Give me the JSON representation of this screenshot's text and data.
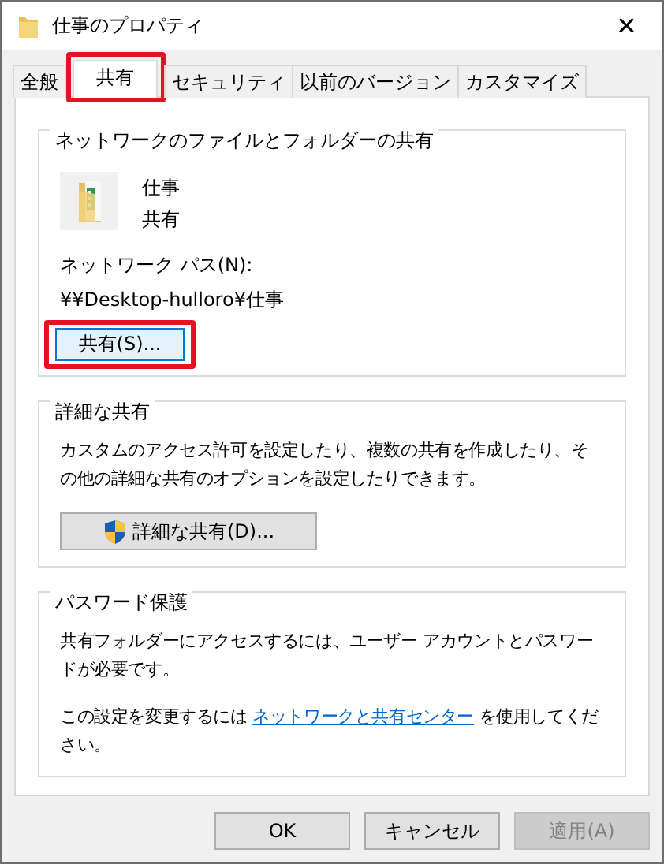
{
  "window": {
    "title": "仕事のプロパティ",
    "close": "✕"
  },
  "tabs": [
    {
      "label": "全般",
      "selected": false,
      "highlighted": false
    },
    {
      "label": "共有",
      "selected": true,
      "highlighted": true
    },
    {
      "label": "セキュリティ",
      "selected": false,
      "highlighted": false
    },
    {
      "label": "以前のバージョン",
      "selected": false,
      "highlighted": false
    },
    {
      "label": "カスタマイズ",
      "selected": false,
      "highlighted": false
    }
  ],
  "network_sharing": {
    "title": "ネットワークのファイルとフォルダーの共有",
    "folder_name": "仕事",
    "folder_state": "共有",
    "path_label": "ネットワーク パス(N):",
    "path": "¥¥Desktop-hulloro¥仕事",
    "button": {
      "label": "共有(S)...",
      "highlighted": true
    }
  },
  "advanced_sharing": {
    "title": "詳細な共有",
    "description": "カスタムのアクセス許可を設定したり、複数の共有を作成したり、その他の詳細な共有のオプションを設定したりできます。",
    "button": {
      "label": "詳細な共有(D)..."
    }
  },
  "password_protection": {
    "title": "パスワード保護",
    "description": "共有フォルダーにアクセスするには、ユーザー アカウントとパスワードが必要です。",
    "note_before": "この設定を変更するには ",
    "link": "ネットワークと共有センター",
    "note_after": " を使用してください。"
  },
  "buttons": [
    {
      "label": "OK",
      "disabled": false
    },
    {
      "label": "キャンセル",
      "disabled": false
    },
    {
      "label": "適用(A)",
      "disabled": true
    }
  ]
}
